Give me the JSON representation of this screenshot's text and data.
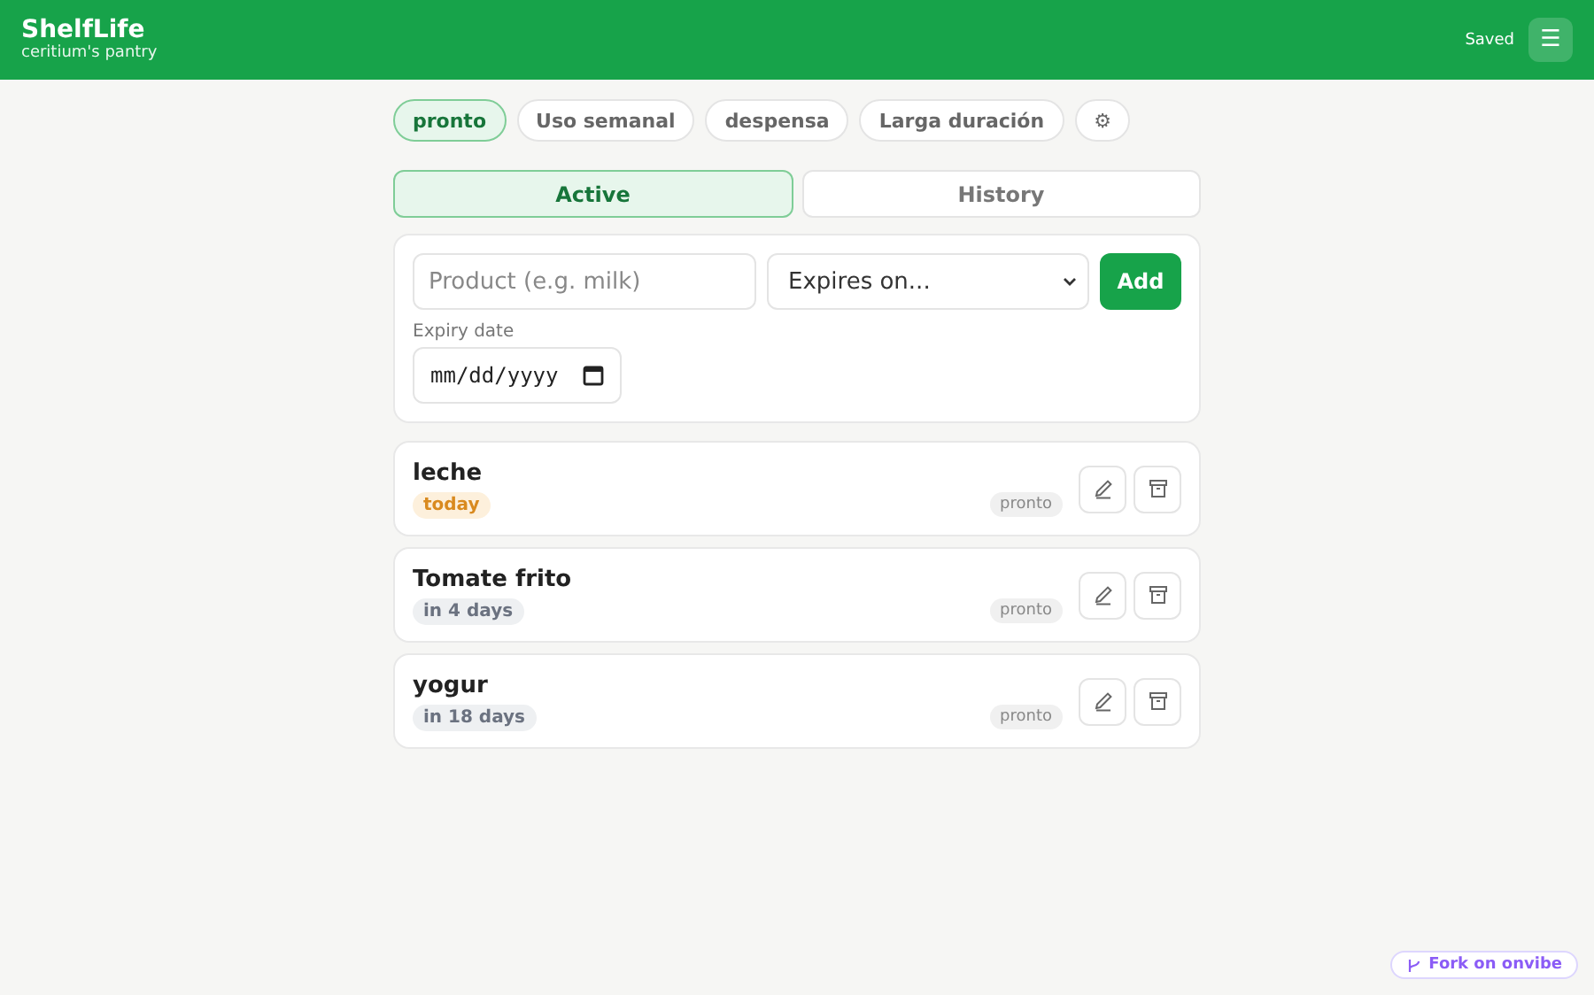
{
  "header": {
    "title": "ShelfLife",
    "subtitle": "ceritium's pantry",
    "status": "Saved",
    "menu_icon": "☰"
  },
  "filters": [
    {
      "label": "pronto",
      "selected": true
    },
    {
      "label": "Uso semanal",
      "selected": false
    },
    {
      "label": "despensa",
      "selected": false
    },
    {
      "label": "Larga duración",
      "selected": false
    },
    {
      "label": "⚙",
      "selected": false
    }
  ],
  "tabs": [
    {
      "label": "Active",
      "selected": true
    },
    {
      "label": "History",
      "selected": false
    }
  ],
  "form": {
    "product_placeholder": "Product (e.g. milk)",
    "expiry_select": "Expires on...",
    "add_button": "Add",
    "date_label": "Expiry date",
    "date_value": "mm/dd/yyyy"
  },
  "items": [
    {
      "name": "leche",
      "due": "today",
      "kind": "urgent",
      "tag": "pronto"
    },
    {
      "name": "Tomate frito",
      "due": "in 4 days",
      "kind": "normal",
      "tag": "pronto"
    },
    {
      "name": "yogur",
      "due": "in 18 days",
      "kind": "normal",
      "tag": "pronto"
    }
  ],
  "fork_link": "Fork on onvibe"
}
